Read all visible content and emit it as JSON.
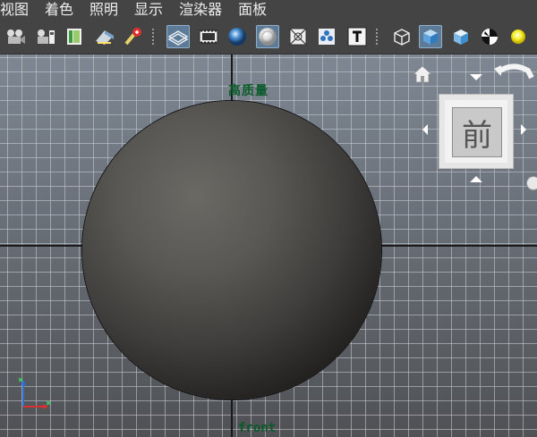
{
  "menu": [
    "视图",
    "着色",
    "照明",
    "显示",
    "渲染器",
    "面板"
  ],
  "toolbar": {
    "groups": [
      [
        "camera-attributes-icon",
        "bookmark-camera-icon",
        "image-plane-icon",
        "2d-pan-zoom-icon",
        "grease-pencil-icon"
      ],
      [
        "wireframe-shaded-icon",
        "film-gate-icon",
        "smooth-shade-icon",
        "wireframe-on-shaded-icon",
        "xray-icon",
        "isolate-select-icon",
        "texture-icon"
      ],
      [
        "bounding-box-icon",
        "smooth-shade-all-icon",
        "default-material-icon",
        "checker-icon",
        "lighting-icon"
      ]
    ],
    "active": [
      "wireframe-shaded-icon",
      "wireframe-on-shaded-icon",
      "smooth-shade-all-icon"
    ]
  },
  "viewport": {
    "quality_label": "高质量",
    "camera_name": "front",
    "viewcube_face": "前"
  },
  "colors": {
    "menubar_bg": "#444444",
    "label_green": "#0b5a2a",
    "active_button": "#5d7a96"
  }
}
